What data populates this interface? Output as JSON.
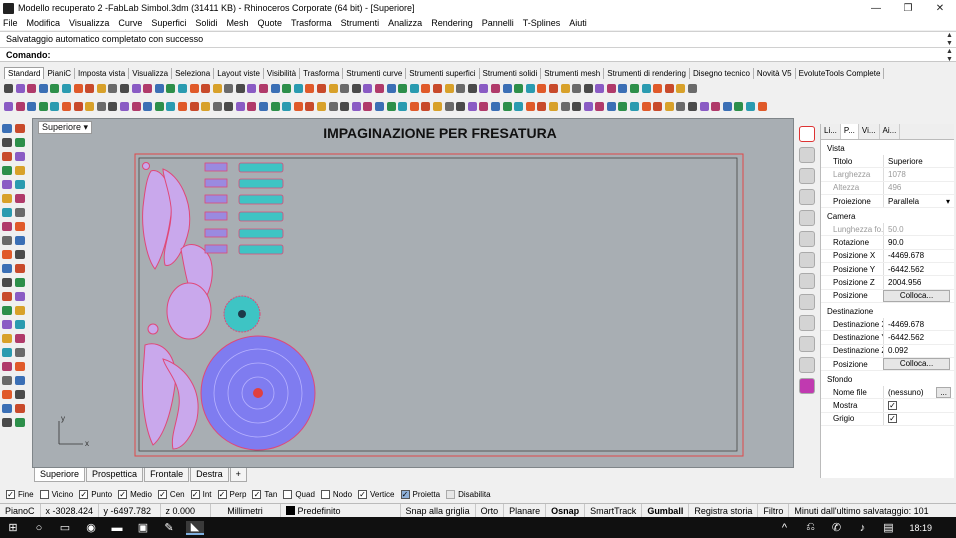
{
  "window": {
    "title": "Modello recuperato 2 -FabLab Simbol.3dm (31411 KB) - Rhinoceros Corporate (64 bit) - [Superiore]",
    "min_icon": "—",
    "max_icon": "❐",
    "close_icon": "✕"
  },
  "menu": [
    "File",
    "Modifica",
    "Visualizza",
    "Curve",
    "Superfici",
    "Solidi",
    "Mesh",
    "Quote",
    "Trasforma",
    "Strumenti",
    "Analizza",
    "Rendering",
    "Pannelli",
    "T-Splines",
    "Aiuti"
  ],
  "command": {
    "history": "Salvataggio automatico completato con successo",
    "prompt": "Comando:"
  },
  "toolbar_tabs": [
    "Standard",
    "PianiC",
    "Imposta vista",
    "Visualizza",
    "Seleziona",
    "Layout viste",
    "Visibilità",
    "Trasforma",
    "Strumenti curve",
    "Strumenti superfici",
    "Strumenti solidi",
    "Strumenti mesh",
    "Strumenti di rendering",
    "Disegno tecnico",
    "Novità V5",
    "EvoluteTools Complete"
  ],
  "viewport": {
    "label": "Superiore",
    "title": "IMPAGINAZIONE PER FRESATURA",
    "axis_x": "x",
    "axis_y": "y",
    "bg_color": "#a8aeb3",
    "accent_red": "#e0453e"
  },
  "viewport_tabs": [
    "Superiore",
    "Prospettica",
    "Frontale",
    "Destra",
    "+"
  ],
  "panel": {
    "tabs": [
      "Li...",
      "P...",
      "Vi...",
      "Ai..."
    ],
    "sections": {
      "vista": "Vista",
      "camera": "Camera",
      "destinazione": "Destinazione",
      "sfondo": "Sfondo"
    },
    "vista_rows": [
      {
        "k": "Titolo",
        "v": "Superiore",
        "dis": false
      },
      {
        "k": "Larghezza",
        "v": "1078",
        "dis": true
      },
      {
        "k": "Altezza",
        "v": "496",
        "dis": true
      },
      {
        "k": "Proiezione",
        "v": "Parallela",
        "dis": false
      }
    ],
    "camera_rows": [
      {
        "k": "Lunghezza fo...",
        "v": "50.0",
        "dis": true
      },
      {
        "k": "Rotazione",
        "v": "90.0",
        "dis": false
      },
      {
        "k": "Posizione X",
        "v": "-4469.678",
        "dis": false
      },
      {
        "k": "Posizione Y",
        "v": "-6442.562",
        "dis": false
      },
      {
        "k": "Posizione Z",
        "v": "2004.956",
        "dis": false
      }
    ],
    "camera_pos_label": "Posizione",
    "colloca": "Colloca...",
    "dest_rows": [
      {
        "k": "Destinazione X",
        "v": "-4469.678",
        "dis": false
      },
      {
        "k": "Destinazione Y",
        "v": "-6442.562",
        "dis": false
      },
      {
        "k": "Destinazione Z",
        "v": "0.092",
        "dis": false
      }
    ],
    "dest_pos_label": "Posizione",
    "sfondo": {
      "file_label": "Nome file",
      "file_value": "(nessuno)",
      "file_btn": "...",
      "mostra": "Mostra",
      "grigio": "Grigio"
    }
  },
  "osnaps": [
    {
      "label": "Fine",
      "checked": true
    },
    {
      "label": "Vicino",
      "checked": false
    },
    {
      "label": "Punto",
      "checked": true
    },
    {
      "label": "Medio",
      "checked": true
    },
    {
      "label": "Cen",
      "checked": true
    },
    {
      "label": "Int",
      "checked": true
    },
    {
      "label": "Perp",
      "checked": true
    },
    {
      "label": "Tan",
      "checked": true
    },
    {
      "label": "Quad",
      "checked": false
    },
    {
      "label": "Nodo",
      "checked": false
    },
    {
      "label": "Vertice",
      "checked": true
    },
    {
      "label": "Proietta",
      "checked": true
    },
    {
      "label": "Disabilita",
      "checked": false
    }
  ],
  "status": {
    "plane": "PianoC",
    "x": "x -3028.424",
    "y": "y -6497.782",
    "z": "z 0.000",
    "units": "Millimetri",
    "layer": "Predefinito",
    "grid_snap": "Snap alla griglia",
    "orto": "Orto",
    "planare": "Planare",
    "osnap": "Osnap",
    "smarttrack": "SmartTrack",
    "gumball": "Gumball",
    "history": "Registra storia",
    "filtro": "Filtro",
    "saved": "Minuti dall'ultimo salvataggio: 101"
  },
  "taskbar": {
    "time": "18:19"
  }
}
